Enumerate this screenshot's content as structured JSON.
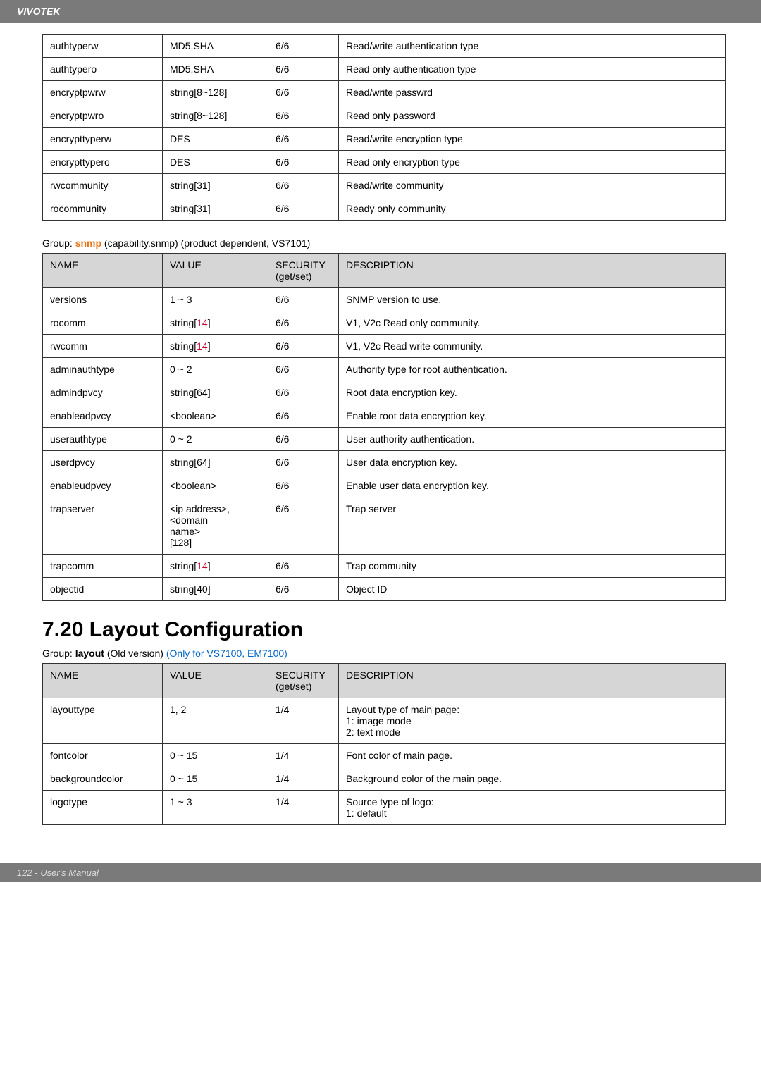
{
  "header": {
    "brand": "VIVOTEK"
  },
  "table1": {
    "rows": [
      {
        "n": "authtyperw",
        "v": "MD5,SHA",
        "s": "6/6",
        "d": "Read/write authentication type"
      },
      {
        "n": "authtypero",
        "v": "MD5,SHA",
        "s": "6/6",
        "d": "Read only authentication type"
      },
      {
        "n": "encryptpwrw",
        "v": "string[8~128]",
        "s": "6/6",
        "d": "Read/write passwrd"
      },
      {
        "n": "encryptpwro",
        "v": "string[8~128]",
        "s": "6/6",
        "d": "Read only password"
      },
      {
        "n": "encrypttyperw",
        "v": "DES",
        "s": "6/6",
        "d": "Read/write encryption type"
      },
      {
        "n": "encrypttypero",
        "v": "DES",
        "s": "6/6",
        "d": "Read only encryption type"
      },
      {
        "n": "rwcommunity",
        "v": "string[31]",
        "s": "6/6",
        "d": "Read/write community"
      },
      {
        "n": "rocommunity",
        "v": "string[31]",
        "s": "6/6",
        "d": "Ready only community"
      }
    ]
  },
  "caption2": {
    "prefix": "Group: ",
    "group_name": "snmp",
    "suffix": " (capability.snmp) (product dependent, VS7101)"
  },
  "table2": {
    "headers": {
      "name": "NAME",
      "value": "VALUE",
      "sec1": "SECURITY",
      "sec2": "(get/set)",
      "desc": "DESCRIPTION"
    },
    "rows": [
      {
        "n": "versions",
        "v": "1 ~ 3",
        "s": "6/6",
        "d": "SNMP version to use."
      },
      {
        "n": "rocomm",
        "v_pre": "string[",
        "v_num": "14",
        "v_post": "]",
        "s": "6/6",
        "d": "V1, V2c Read only community."
      },
      {
        "n": "rwcomm",
        "v_pre": "string[",
        "v_num": "14",
        "v_post": "]",
        "s": "6/6",
        "d": "V1, V2c Read write community."
      },
      {
        "n": "adminauthtype",
        "v": "0 ~ 2",
        "s": "6/6",
        "d": "Authority type for root authentication."
      },
      {
        "n": "admindpvcy",
        "v": "string[64]",
        "s": "6/6",
        "d": "Root data encryption key."
      },
      {
        "n": "enableadpvcy",
        "v": "<boolean>",
        "s": "6/6",
        "d": "Enable root data encryption key."
      },
      {
        "n": "userauthtype",
        "v": "0 ~ 2",
        "s": "6/6",
        "d": "User authority authentication."
      },
      {
        "n": "userdpvcy",
        "v": "string[64]",
        "s": "6/6",
        "d": "User data encryption key."
      },
      {
        "n": "enableudpvcy",
        "v": "<boolean>",
        "s": "6/6",
        "d": "Enable user data encryption key."
      },
      {
        "n": "trapserver",
        "v1": "<ip address>,",
        "v2": "<domain",
        "v3": "name>",
        "v4": "[128]",
        "s": "6/6",
        "d": "Trap server"
      },
      {
        "n": "trapcomm",
        "v_pre": "string[",
        "v_num": "14",
        "v_post": "]",
        "s": "6/6",
        "d": "Trap community"
      },
      {
        "n": "objectid",
        "v": "string[40]",
        "s": "6/6",
        "d": "Object ID"
      }
    ]
  },
  "section": {
    "title": "7.20 Layout Configuration"
  },
  "caption3": {
    "prefix": "Group: ",
    "group_name": "layout",
    "middle": " (Old version) ",
    "blue": "(Only for VS7100, EM7100)"
  },
  "table3": {
    "headers": {
      "name": "NAME",
      "value": "VALUE",
      "sec1": "SECURITY",
      "sec2": "(get/set)",
      "desc": "DESCRIPTION"
    },
    "rows": [
      {
        "n": "layouttype",
        "v": "1, 2",
        "s": "1/4",
        "d1": "Layout type of main page:",
        "d2": "1: image mode",
        "d3": "2: text mode"
      },
      {
        "n": "fontcolor",
        "v": "0 ~ 15",
        "s": "1/4",
        "d": "Font color of main page."
      },
      {
        "n": "backgroundcolor",
        "v": "0 ~ 15",
        "s": "1/4",
        "d": "Background color of the main page."
      },
      {
        "n": "logotype",
        "v": "1 ~ 3",
        "s": "1/4",
        "d1": "Source type of logo:",
        "d2": "1: default"
      }
    ]
  },
  "footer": {
    "text": "122 - User's Manual"
  }
}
